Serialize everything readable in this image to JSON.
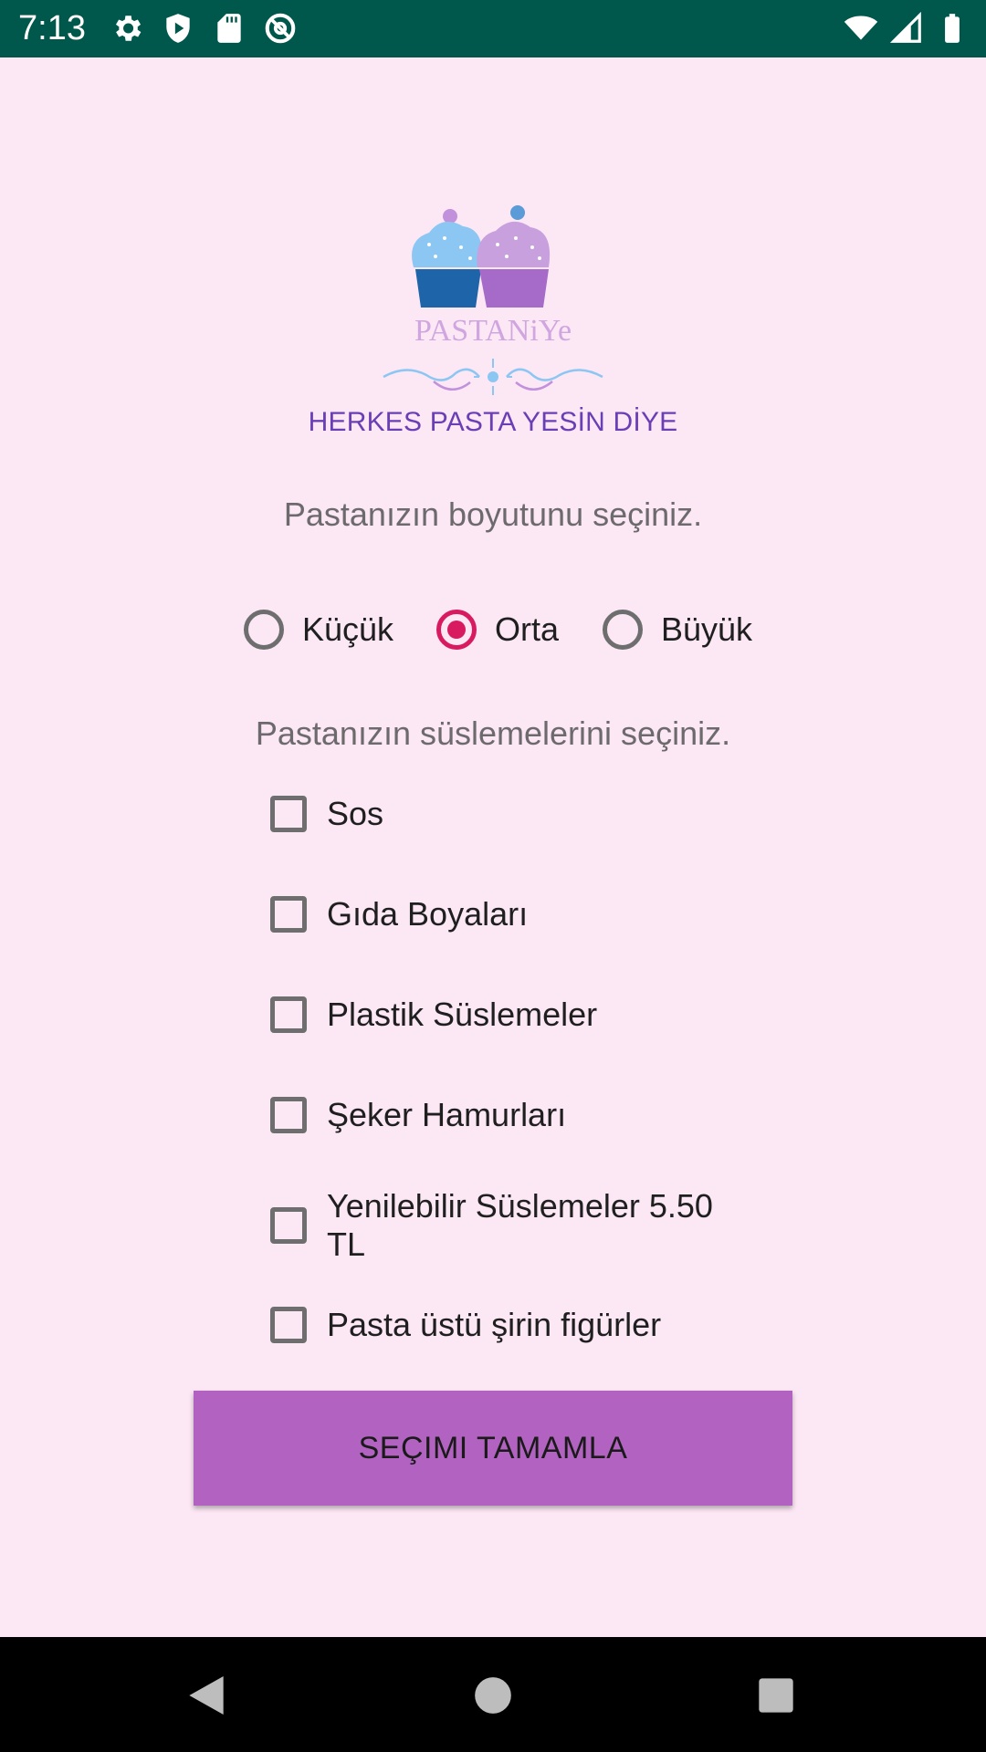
{
  "status_bar": {
    "time": "7:13",
    "left_icons": [
      "gear-icon",
      "play-protect-icon",
      "sd-card-icon",
      "at-sign-icon"
    ],
    "right_icons": [
      "wifi-icon",
      "cell-signal-icon",
      "battery-icon"
    ],
    "background": "#00574b"
  },
  "logo": {
    "brand_text": "PASTANiYe"
  },
  "tagline": "HERKES PASTA YESİN DİYE",
  "size_prompt": "Pastanızın boyutunu seçiniz.",
  "size_options": [
    {
      "label": "Küçük",
      "selected": false
    },
    {
      "label": "Orta",
      "selected": true
    },
    {
      "label": "Büyük",
      "selected": false
    }
  ],
  "decor_prompt": "Pastanızın süslemelerini seçiniz.",
  "decorations": [
    {
      "line1": "Sos",
      "line2": "",
      "checked": false
    },
    {
      "line1": "Gıda Boyaları",
      "line2": "",
      "checked": false
    },
    {
      "line1": "Plastik Süslemeler",
      "line2": "",
      "checked": false
    },
    {
      "line1": "Şeker Hamurları",
      "line2": "",
      "checked": false
    },
    {
      "line1": "Yenilebilir Süslemeler 5.50",
      "line2": "TL",
      "checked": false
    },
    {
      "line1": "Pasta üstü şirin figürler",
      "line2": "",
      "checked": false
    }
  ],
  "submit_label": "SEÇIMI TAMAMLA",
  "colors": {
    "background": "#fce7f5",
    "accent": "#d81b60",
    "button": "#b262c1",
    "tagline": "#6a3fb5"
  },
  "nav_bar": {
    "buttons": [
      "back-icon",
      "home-icon",
      "recents-icon"
    ]
  }
}
